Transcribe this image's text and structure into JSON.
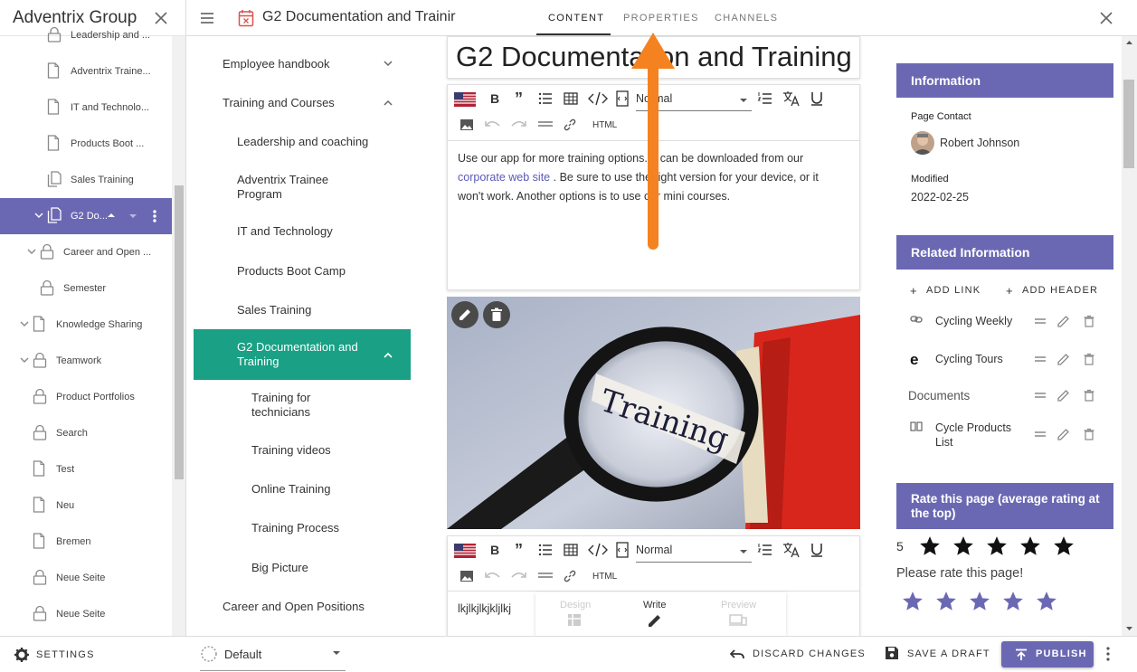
{
  "left_panel": {
    "title": "Adventrix Group",
    "items": [
      {
        "label": "Leadership and ...",
        "icon": "lock-icon"
      },
      {
        "label": "Adventrix Traine...",
        "icon": "page-icon"
      },
      {
        "label": "IT and Technolo...",
        "icon": "page-icon"
      },
      {
        "label": "Products Boot ...",
        "icon": "page-icon"
      },
      {
        "label": "Sales Training",
        "icon": "pages-icon"
      },
      {
        "label": "G2 Do...",
        "icon": "pages-icon"
      },
      {
        "label": "Career and Open ...",
        "icon": "lock-icon"
      },
      {
        "label": "Semester",
        "icon": "lock-icon"
      },
      {
        "label": "Knowledge Sharing",
        "icon": "page-icon"
      },
      {
        "label": "Teamwork",
        "icon": "lock-icon"
      },
      {
        "label": "Product Portfolios",
        "icon": "lock-icon"
      },
      {
        "label": "Search",
        "icon": "lock-icon"
      },
      {
        "label": "Test",
        "icon": "page-icon"
      },
      {
        "label": "Neu",
        "icon": "page-icon"
      },
      {
        "label": "Bremen",
        "icon": "page-icon"
      },
      {
        "label": "Neue Seite",
        "icon": "lock-icon"
      },
      {
        "label": "Neue Seite",
        "icon": "lock-icon"
      }
    ]
  },
  "bottom": {
    "settings": "SETTINGS",
    "variant": "Default",
    "discard": "DISCARD CHANGES",
    "save_draft": "SAVE A DRAFT",
    "publish": "PUBLISH"
  },
  "top": {
    "page_title": "G2 Documentation and Trainir",
    "tabs": [
      "CONTENT",
      "PROPERTIES",
      "CHANNELS"
    ],
    "active_tab": "CONTENT"
  },
  "nav": {
    "items": [
      "Employee handbook",
      "Training and Courses",
      "Leadership and coaching",
      "Adventrix Trainee Program",
      "IT and Technology",
      "Products Boot Camp",
      "Sales Training",
      "G2 Documentation and Training",
      "Training for technicians",
      "Training videos",
      "Online Training",
      "Training Process",
      "Big Picture",
      "Career and Open Positions"
    ]
  },
  "editor": {
    "heading": "G2 Documentation and Training",
    "format_select": "Normal",
    "html_label": "HTML",
    "text_before_link": "Use our app for more training options. It can be downloaded from our",
    "link_text": "corporate web site",
    "text_after_link": ". Be sure to use the right version for your device, or it won't work. Another options is to use our mini courses.",
    "image_word": "Training",
    "second_text": "lkjlkjlkjkljlkj",
    "modes": [
      "Design",
      "Write",
      "Preview"
    ],
    "active_mode": "Write"
  },
  "right": {
    "information": {
      "title": "Information",
      "page_contact_label": "Page Contact",
      "page_contact": "Robert Johnson",
      "modified_label": "Modified",
      "modified": "2022-02-25"
    },
    "related": {
      "title": "Related Information",
      "add_link": "ADD LINK",
      "add_header": "ADD HEADER",
      "items": [
        {
          "label": "Cycling Weekly",
          "icon": "link-icon"
        },
        {
          "label": "Cycling Tours",
          "icon": "edge-browser-icon"
        },
        {
          "label": "Documents",
          "icon": ""
        },
        {
          "label": "Cycle Products List",
          "icon": "book-icon"
        }
      ]
    },
    "rating": {
      "title": "Rate this page (average rating at the top)",
      "average": "5",
      "average_stars": 5,
      "prompt": "Please rate this page!",
      "max_stars": 5
    }
  },
  "colors": {
    "accent": "#6b68b3",
    "nav_selected": "#19a085",
    "link": "#5a5ab8",
    "arrow": "#f58220"
  }
}
